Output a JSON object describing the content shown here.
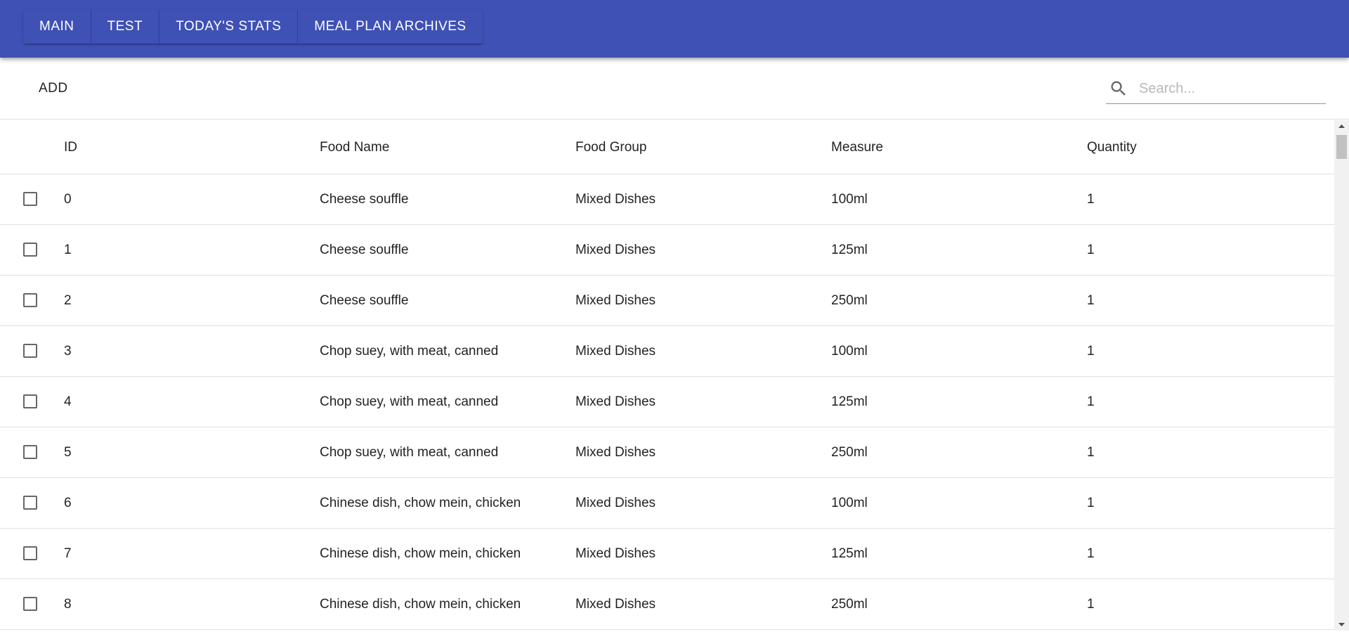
{
  "nav": {
    "buttons": [
      "Main",
      "Test",
      "Today's Stats",
      "Meal Plan Archives"
    ]
  },
  "toolbar": {
    "add_label": "Add",
    "search_placeholder": "Search...",
    "search_value": ""
  },
  "table": {
    "columns": [
      "ID",
      "Food Name",
      "Food Group",
      "Measure",
      "Quantity"
    ],
    "rows": [
      {
        "id": "0",
        "name": "Cheese souffle",
        "group": "Mixed Dishes",
        "measure": "100ml",
        "qty": "1"
      },
      {
        "id": "1",
        "name": "Cheese souffle",
        "group": "Mixed Dishes",
        "measure": "125ml",
        "qty": "1"
      },
      {
        "id": "2",
        "name": "Cheese souffle",
        "group": "Mixed Dishes",
        "measure": "250ml",
        "qty": "1"
      },
      {
        "id": "3",
        "name": "Chop suey, with meat, canned",
        "group": "Mixed Dishes",
        "measure": "100ml",
        "qty": "1"
      },
      {
        "id": "4",
        "name": "Chop suey, with meat, canned",
        "group": "Mixed Dishes",
        "measure": "125ml",
        "qty": "1"
      },
      {
        "id": "5",
        "name": "Chop suey, with meat, canned",
        "group": "Mixed Dishes",
        "measure": "250ml",
        "qty": "1"
      },
      {
        "id": "6",
        "name": "Chinese dish, chow mein, chicken",
        "group": "Mixed Dishes",
        "measure": "100ml",
        "qty": "1"
      },
      {
        "id": "7",
        "name": "Chinese dish, chow mein, chicken",
        "group": "Mixed Dishes",
        "measure": "125ml",
        "qty": "1"
      },
      {
        "id": "8",
        "name": "Chinese dish, chow mein, chicken",
        "group": "Mixed Dishes",
        "measure": "250ml",
        "qty": "1"
      }
    ]
  },
  "colors": {
    "primary": "#3f51b5",
    "primary_dark": "#303f9f"
  },
  "icons": {
    "search": "search-icon",
    "checkbox": "checkbox-outline-icon"
  }
}
